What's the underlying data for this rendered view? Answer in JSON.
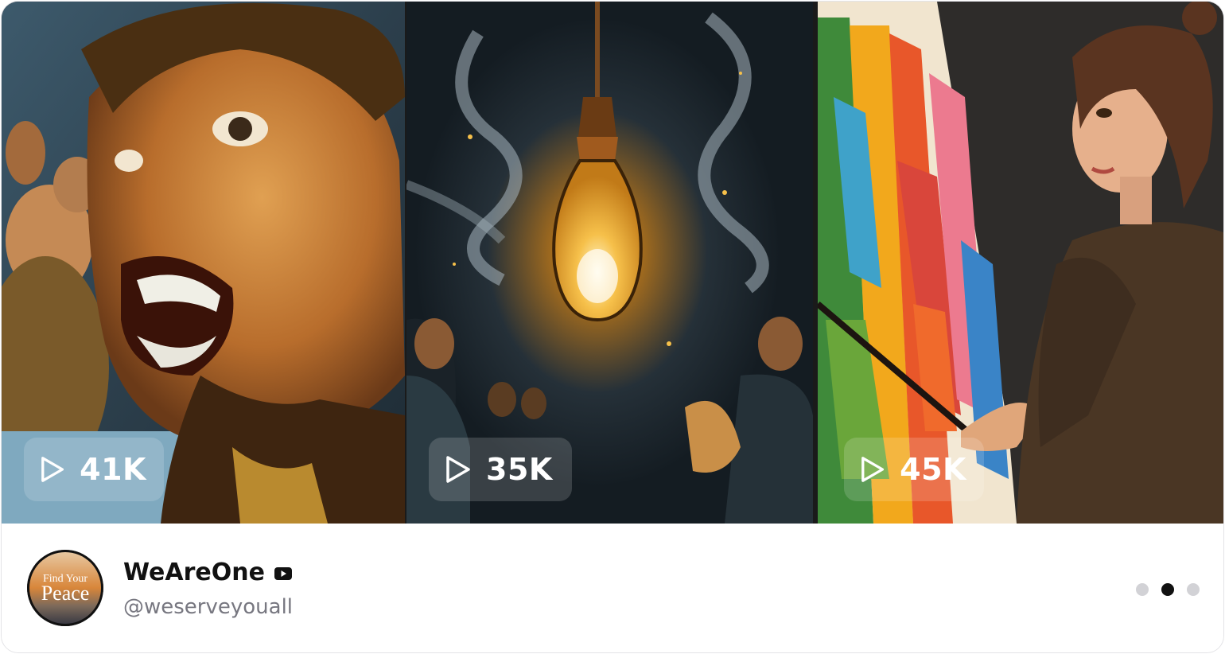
{
  "videos": [
    {
      "views": "41K",
      "thumbnail": "shouting-man-in-crowd"
    },
    {
      "views": "35K",
      "thumbnail": "glowing-lightbulb-with-audience"
    },
    {
      "views": "45K",
      "thumbnail": "woman-painting-canvas"
    }
  ],
  "channel": {
    "name": "WeAreOne",
    "handle": "@weserveyouall",
    "avatar_line1": "Find Your",
    "avatar_line2": "Peace",
    "platform_icon": "youtube-icon"
  },
  "pagination": {
    "total": 3,
    "active_index": 1
  },
  "colors": {
    "card_border": "#e3e3e6",
    "active_dot": "#111111",
    "inactive_dot": "#d2d2d6",
    "handle_text": "#777780"
  }
}
